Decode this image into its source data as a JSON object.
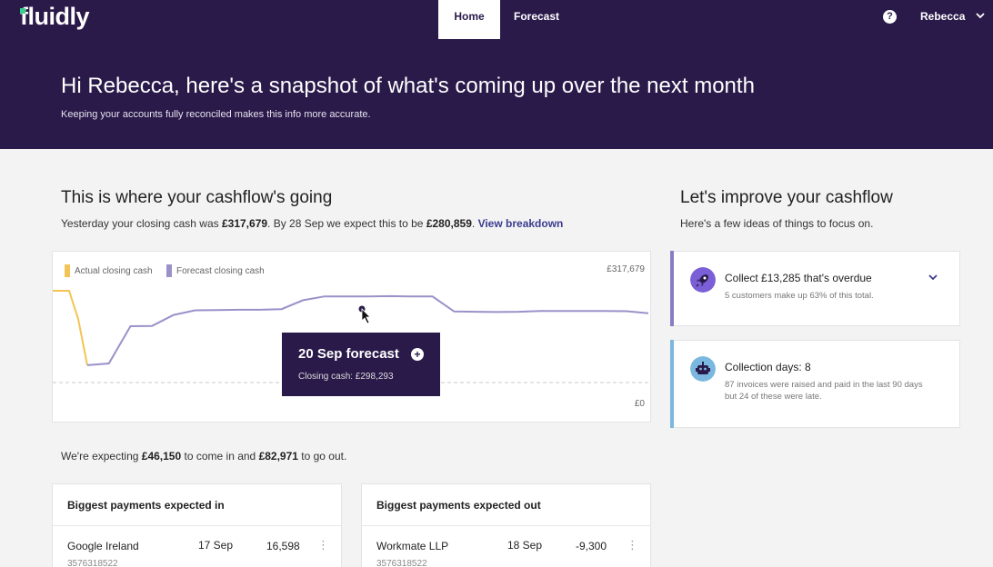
{
  "app": {
    "logo": "fluidly",
    "nav": {
      "home": "Home",
      "forecast": "Forecast"
    },
    "help": "?",
    "user": "Rebecca",
    "colors": {
      "header": "#2a1a4a",
      "accent_green": "#3ccf8e",
      "actual_line": "#f3c455",
      "forecast_line": "#9a91c9"
    }
  },
  "hero": {
    "title": "Hi Rebecca, here's a snapshot of what's coming up over the next month",
    "subtitle": "Keeping your accounts fully reconciled makes this info more accurate."
  },
  "cashflow": {
    "title": "This is where your cashflow's going",
    "summary_a": "Yesterday your closing cash was ",
    "closing_cash": "£317,679",
    "summary_b": ". By 28 Sep we expect this to be ",
    "expected_cash": "£280,859",
    "summary_c": ". ",
    "view_breakdown": "View breakdown"
  },
  "chart_data": {
    "type": "line",
    "legend": [
      "Actual closing cash",
      "Forecast closing cash"
    ],
    "y_max_label": "£317,679",
    "y_min_label": "£0",
    "ylim": [
      0,
      317679
    ],
    "series": [
      {
        "name": "Actual closing cash",
        "values": [
          317679,
          317679,
          220000,
          60000
        ]
      },
      {
        "name": "Forecast closing cash",
        "values": [
          60000,
          66000,
          195000,
          196000,
          234000,
          250000,
          251000,
          252000,
          252000,
          254000,
          285000,
          298293,
          298293,
          298000,
          299000,
          298000,
          298000,
          246000,
          245000,
          244000,
          245000,
          248000,
          248000,
          248000,
          248000,
          247000,
          240000
        ]
      }
    ],
    "tooltip": {
      "title": "20 Sep forecast",
      "plus": "+",
      "detail": "Closing cash: £298,293"
    }
  },
  "expecting": {
    "a": "We're expecting ",
    "in_amount": "£46,150",
    "b": " to come in and ",
    "out_amount": "£82,971",
    "c": " to go out."
  },
  "payments_in": {
    "title": "Biggest payments expected in",
    "rows": [
      {
        "name": "Google Ireland",
        "ref": "3576318522",
        "date": "17 Sep",
        "amount": "16,598",
        "more": "⋮"
      }
    ]
  },
  "payments_out": {
    "title": "Biggest payments expected out",
    "rows": [
      {
        "name": "Workmate LLP",
        "ref": "3576318522",
        "date": "18 Sep",
        "amount": "-9,300",
        "more": "⋮"
      }
    ]
  },
  "improve": {
    "title": "Let's improve your cashflow",
    "subtitle": "Here's a few ideas of things to focus on.",
    "tips": [
      {
        "icon": "rocket-icon",
        "title": "Collect £13,285 that's overdue",
        "text": "5 customers make up 63% of this total.",
        "bar_color": "#8a7cc4",
        "icon_bg": "#7b5fd6"
      },
      {
        "icon": "robot-icon",
        "title": "Collection days: 8",
        "text": "87 invoices were raised and paid in the last 90 days but 24 of these were late.",
        "bar_color": "#7bb8e0",
        "icon_bg": "#7bb8e0"
      }
    ]
  }
}
